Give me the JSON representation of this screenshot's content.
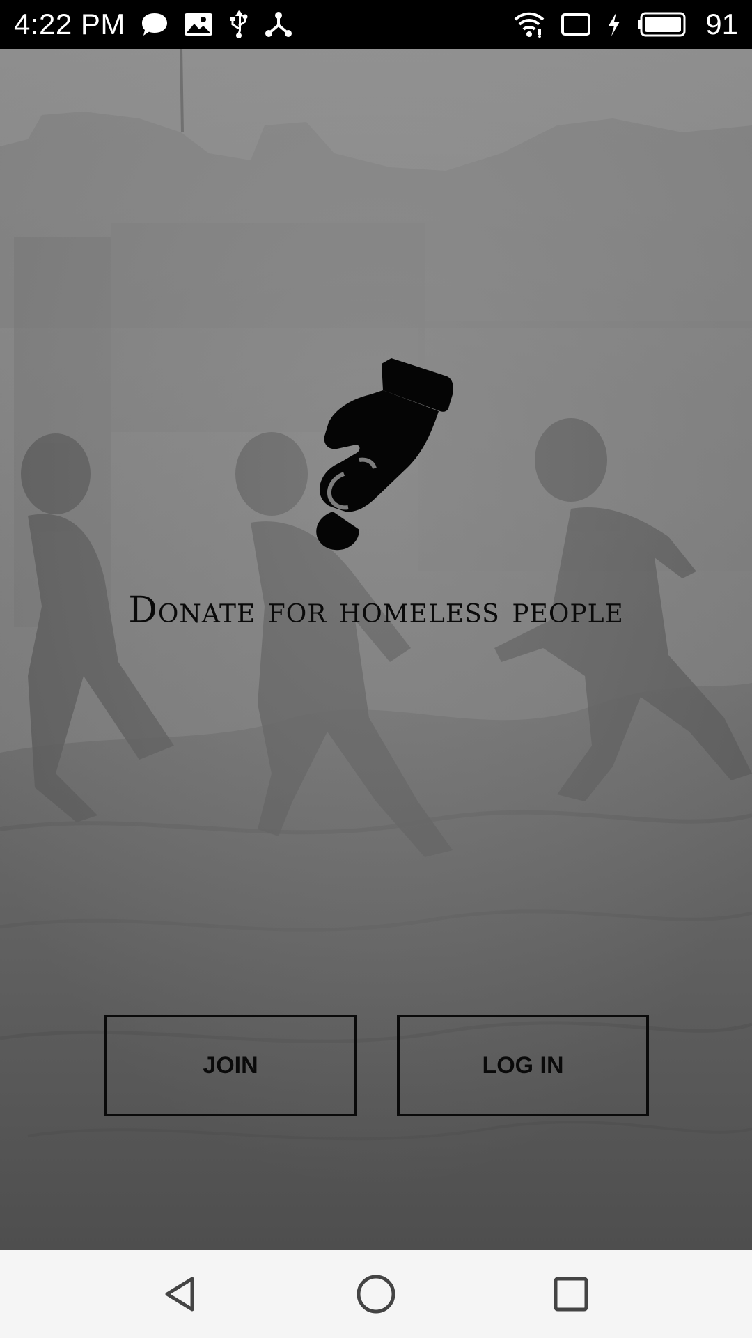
{
  "status_bar": {
    "time": "4:22 PM",
    "battery_level": "91",
    "left_icons": [
      "chat-bubble-icon",
      "image-icon",
      "usb-icon",
      "share-network-icon"
    ],
    "right_icons": [
      "wifi-icon",
      "cast-icon",
      "charging-bolt-icon",
      "battery-icon"
    ]
  },
  "app": {
    "logo_icon": "donation-hand-icon",
    "tagline": "Donate for homeless people"
  },
  "buttons": {
    "join_label": "JOIN",
    "login_label": "LOG IN"
  },
  "nav_bar": {
    "back_icon": "back-triangle-icon",
    "home_icon": "home-circle-icon",
    "recents_icon": "recents-square-icon"
  },
  "colors": {
    "status_bar_bg": "#000000",
    "nav_bar_bg": "#f5f5f5",
    "text_primary": "#0a0a0a",
    "overlay_gray": "#6e6e6e"
  }
}
